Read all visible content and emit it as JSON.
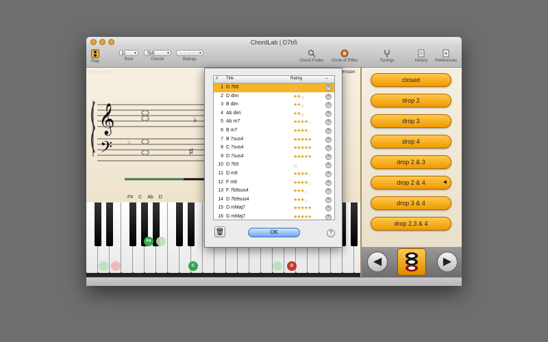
{
  "window": {
    "title": "ChordLab | D7b5"
  },
  "toolbar": {
    "play_label": "Play",
    "root_value": "D",
    "root_label": "Root",
    "chord_value": "7b5",
    "chords_label": "Chords",
    "ratings_value": "☆☆☆☆☆",
    "ratings_label": "Ratings",
    "chord_finder_label": "Chord Finder",
    "circle_label": "Circle of Fifths",
    "tunings_label": "Tunings",
    "history_label": "History",
    "preferences_label": "Preferences"
  },
  "score": {
    "rating_stars": "☆☆☆☆☆",
    "inversion_label": "version",
    "note_names": [
      "F#",
      "C",
      "Ab",
      "D"
    ]
  },
  "piano": {
    "marked_notes": [
      {
        "label": "F#",
        "color": "#2ea84a"
      },
      {
        "label": "C",
        "color": "#2ea84a"
      },
      {
        "label": "D",
        "color": "#c0392b"
      }
    ]
  },
  "voicings": [
    "closed",
    "drop 2",
    "drop 3",
    "drop 4",
    "drop 2 & 3",
    "drop 2 & 4",
    "drop 3 & 4",
    "drop 2,3 & 4"
  ],
  "voicing_selected_index": 5,
  "history": {
    "headers": {
      "num": "#",
      "title": "Title",
      "rating": "Rating",
      "del": "–"
    },
    "rows": [
      {
        "num": "1",
        "title": "D 7b5",
        "stars": 0
      },
      {
        "num": "2",
        "title": "D dim",
        "stars": 2
      },
      {
        "num": "3",
        "title": "B dim",
        "stars": 2
      },
      {
        "num": "4",
        "title": "Ab dim",
        "stars": 2
      },
      {
        "num": "5",
        "title": "Ab m7",
        "stars": 4
      },
      {
        "num": "6",
        "title": "B m7",
        "stars": 4
      },
      {
        "num": "7",
        "title": "B 7sus4",
        "stars": 5
      },
      {
        "num": "8",
        "title": "C 7sus4",
        "stars": 5
      },
      {
        "num": "9",
        "title": "D 7sus4",
        "stars": 5
      },
      {
        "num": "10",
        "title": "D 7b5",
        "stars": 0
      },
      {
        "num": "11",
        "title": "D m9",
        "stars": 4
      },
      {
        "num": "12",
        "title": "F m9",
        "stars": 4
      },
      {
        "num": "13",
        "title": "F 7b9sus4",
        "stars": 3
      },
      {
        "num": "14",
        "title": "D 7b9sus4",
        "stars": 3
      },
      {
        "num": "15",
        "title": "D mMaj7",
        "stars": 5
      },
      {
        "num": "16",
        "title": "G mMaj7",
        "stars": 5
      }
    ],
    "selected_index": 0,
    "ok_label": "OK",
    "help_label": "?"
  },
  "colors": {
    "accent_orange": "#f5a623",
    "selection": "#f5b52a",
    "ok_blue": "#6fa7ee"
  },
  "icons": {
    "play": "play-icon",
    "chord_finder": "magnifier-icon",
    "circle": "circle-of-fifths-icon",
    "tunings": "tuning-fork-icon",
    "history": "history-icon",
    "preferences": "preferences-icon",
    "trash": "trash-icon"
  }
}
